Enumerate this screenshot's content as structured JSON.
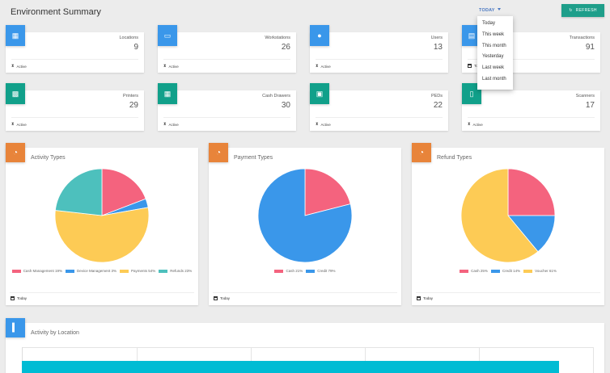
{
  "header": {
    "title": "Environment Summary",
    "filter_label": "TODAY",
    "refresh_label": "REFRESH"
  },
  "dropdown": {
    "items": [
      "Today",
      "This week",
      "This month",
      "Yesterday",
      "Last week",
      "Last month"
    ]
  },
  "stats": [
    {
      "label": "Locations",
      "value": "9",
      "footer": "Active",
      "icon": "store-icon",
      "color": "#3a97ea"
    },
    {
      "label": "Workstations",
      "value": "26",
      "footer": "Active",
      "icon": "laptop-icon",
      "color": "#3a97ea"
    },
    {
      "label": "Users",
      "value": "13",
      "footer": "Active",
      "icon": "user-icon",
      "color": "#3a97ea"
    },
    {
      "label": "Transactions",
      "value": "91",
      "footer": "To",
      "icon": "receipt-icon",
      "color": "#3a97ea"
    },
    {
      "label": "Printers",
      "value": "29",
      "footer": "Active",
      "icon": "printer-icon",
      "color": "#11a08a"
    },
    {
      "label": "Cash Drawers",
      "value": "30",
      "footer": "Active",
      "icon": "cash-drawer-icon",
      "color": "#11a08a"
    },
    {
      "label": "PEDs",
      "value": "22",
      "footer": "Active",
      "icon": "card-terminal-icon",
      "color": "#11a08a"
    },
    {
      "label": "Scanners",
      "value": "17",
      "footer": "Active",
      "icon": "scanner-icon",
      "color": "#11a08a"
    }
  ],
  "charts": {
    "activity": {
      "title": "Activity Types",
      "footer": "Today"
    },
    "payment": {
      "title": "Payment Types",
      "footer": "Today"
    },
    "refund": {
      "title": "Refund Types",
      "footer": "Today"
    }
  },
  "chart_data": [
    {
      "type": "pie",
      "title": "Activity Types",
      "labels": [
        "Cash Management 19%",
        "Device Management 3%",
        "Payments 54%",
        "Refunds 23%"
      ],
      "values": [
        19,
        3,
        54,
        23
      ],
      "colors": [
        "#f4637e",
        "#3a97ea",
        "#fdcb55",
        "#4dc0bd"
      ]
    },
    {
      "type": "pie",
      "title": "Payment Types",
      "labels": [
        "Cash 21%",
        "Credit 79%"
      ],
      "values": [
        21,
        79
      ],
      "colors": [
        "#f4637e",
        "#3a97ea"
      ]
    },
    {
      "type": "pie",
      "title": "Refund Types",
      "labels": [
        "Cash 25%",
        "Credit 14%",
        "Voucher 61%"
      ],
      "values": [
        25,
        14,
        61
      ],
      "colors": [
        "#f4637e",
        "#3a97ea",
        "#fdcb55"
      ]
    },
    {
      "type": "bar",
      "title": "Activity by Location",
      "series": [
        {
          "values": []
        }
      ]
    }
  ],
  "location_chart": {
    "title": "Activity by Location"
  }
}
